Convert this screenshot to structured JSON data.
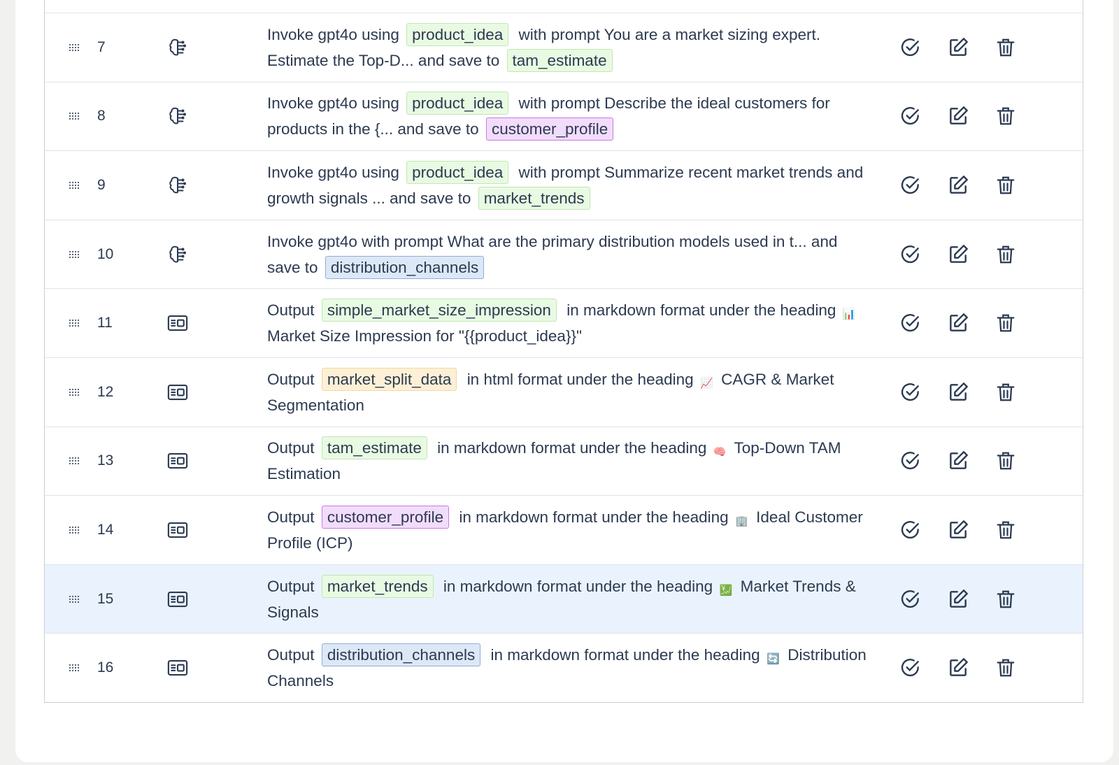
{
  "rows": [
    {
      "num": "7",
      "type": "llm",
      "pre": "Invoke gpt4o using",
      "chip1": "product_idea",
      "mid": "with prompt You are a market sizing expert. Estimate the Top-D... and save to",
      "chip2": "tam_estimate"
    },
    {
      "num": "8",
      "type": "llm",
      "pre": "Invoke gpt4o using",
      "chip1": "product_idea",
      "mid": "with prompt Describe the ideal customers for products in the {... and save to",
      "chip2": "customer_profile"
    },
    {
      "num": "9",
      "type": "llm",
      "pre": "Invoke gpt4o using",
      "chip1": "product_idea",
      "mid": "with prompt Summarize recent market trends and growth signals ... and save to",
      "chip2": "market_trends"
    },
    {
      "num": "10",
      "type": "llm",
      "pre": "Invoke gpt4o with prompt What are the primary distribution models used in t... and save to",
      "chip2": "distribution_channels"
    },
    {
      "num": "11",
      "type": "output",
      "pre": "Output",
      "chip1": "simple_market_size_impression",
      "mid": "in markdown format under the heading",
      "emoji": "📊",
      "tail": "Market Size Impression for \"{{product_idea}}\""
    },
    {
      "num": "12",
      "type": "output",
      "pre": "Output",
      "chip1": "market_split_data",
      "mid": "in html format under the heading",
      "emoji": "📈",
      "tail": "CAGR & Market Segmentation"
    },
    {
      "num": "13",
      "type": "output",
      "pre": "Output",
      "chip1": "tam_estimate",
      "mid": "in markdown format under the heading",
      "emoji": "🧠",
      "tail": "Top-Down TAM Estimation"
    },
    {
      "num": "14",
      "type": "output",
      "pre": "Output",
      "chip1": "customer_profile",
      "mid": "in markdown format under the heading",
      "emoji": "🏢",
      "tail": "Ideal Customer Profile (ICP)"
    },
    {
      "num": "15",
      "type": "output",
      "pre": "Output",
      "chip1": "market_trends",
      "mid": "in markdown format under the heading",
      "emoji": "💹",
      "tail": "Market Trends & Signals"
    },
    {
      "num": "16",
      "type": "output",
      "pre": "Output",
      "chip1": "distribution_channels",
      "mid": "in markdown format under the heading",
      "emoji": "🔄",
      "tail": "Distribution Channels"
    }
  ],
  "colors": {
    "chip_green": "#e9fae3",
    "chip_purple": "#f2dcfb",
    "chip_blue": "#dde8f6",
    "chip_orange": "#fdf0d6",
    "highlight_row": "#eaf3fd"
  }
}
